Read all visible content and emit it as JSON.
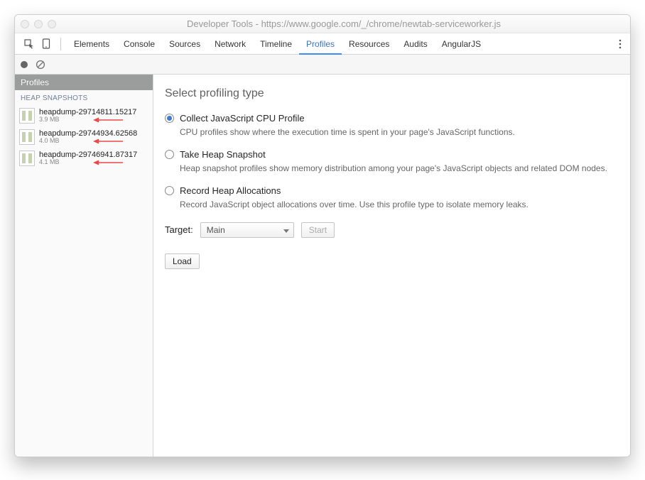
{
  "window": {
    "title_prefix": "Developer Tools - ",
    "url": "https://www.google.com/_/chrome/newtab-serviceworker.js"
  },
  "tabs": [
    "Elements",
    "Console",
    "Sources",
    "Network",
    "Timeline",
    "Profiles",
    "Resources",
    "Audits",
    "AngularJS"
  ],
  "active_tab_index": 5,
  "sidebar": {
    "header": "Profiles",
    "section_label": "HEAP SNAPSHOTS",
    "snapshots": [
      {
        "name": "heapdump-29714811.15217",
        "size": "3.9 MB"
      },
      {
        "name": "heapdump-29744934.62568",
        "size": "4.0 MB"
      },
      {
        "name": "heapdump-29746941.87317",
        "size": "4.1 MB"
      }
    ]
  },
  "main": {
    "heading": "Select profiling type",
    "options": [
      {
        "label": "Collect JavaScript CPU Profile",
        "desc": "CPU profiles show where the execution time is spent in your page's JavaScript functions.",
        "checked": true
      },
      {
        "label": "Take Heap Snapshot",
        "desc": "Heap snapshot profiles show memory distribution among your page's JavaScript objects and related DOM nodes.",
        "checked": false
      },
      {
        "label": "Record Heap Allocations",
        "desc": "Record JavaScript object allocations over time. Use this profile type to isolate memory leaks.",
        "checked": false
      }
    ],
    "target_label": "Target:",
    "target_value": "Main",
    "start_label": "Start",
    "load_label": "Load"
  },
  "annotations": {
    "arrow_color": "#f04646"
  }
}
